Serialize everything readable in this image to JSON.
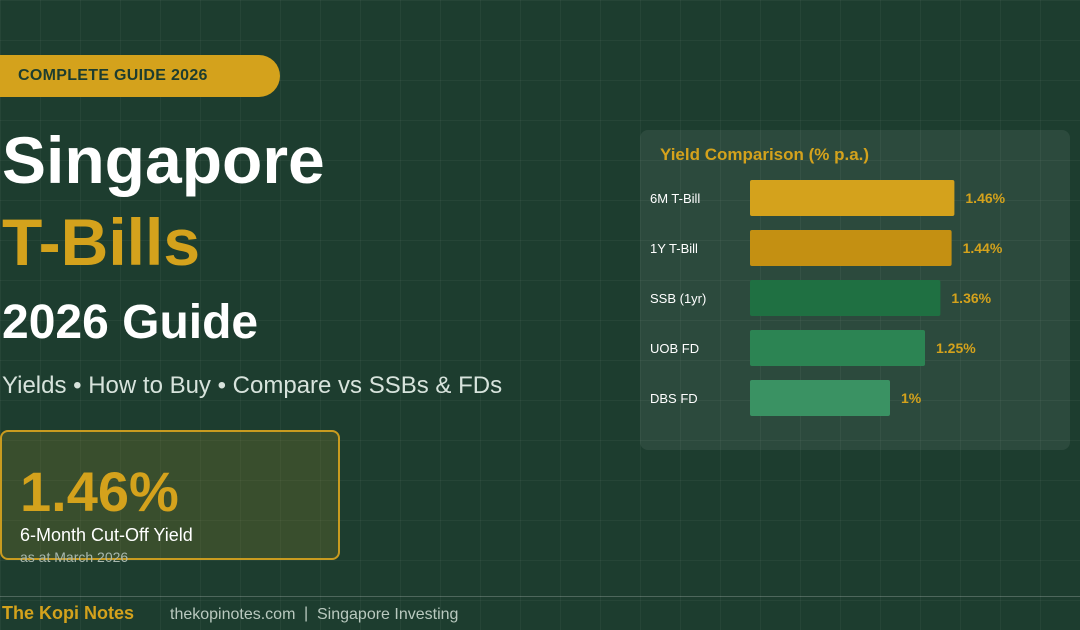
{
  "badge": {
    "label": "COMPLETE GUIDE 2026"
  },
  "headline": {
    "line1": "Singapore",
    "line2": "T-Bills",
    "line3": "2026 Guide",
    "subtitle": "Yields • How to Buy • Compare vs SSBs & FDs"
  },
  "stat": {
    "value": "1.46%",
    "label": "6-Month Cut-Off Yield",
    "date": "as at March 2026"
  },
  "footer": {
    "brand": "The Kopi Notes",
    "site": "thekopinotes.com",
    "separator": "|",
    "tagline": "Singapore Investing"
  },
  "colors": {
    "background": "#1d3d2f",
    "accent_gold": "#d4a21c",
    "green_dark": "#1f7042",
    "green_mid": "#2c8453",
    "green_light": "#3a9263"
  },
  "chart_data": {
    "type": "bar",
    "orientation": "horizontal",
    "title": "Yield Comparison (% p.a.)",
    "categories": [
      "6M T-Bill",
      "1Y T-Bill",
      "SSB (1yr)",
      "UOB FD",
      "DBS FD"
    ],
    "values": [
      1.46,
      1.44,
      1.36,
      1.25,
      1.0
    ],
    "value_labels": [
      "1.46%",
      "1.44%",
      "1.36%",
      "1.25%",
      "1%"
    ],
    "bar_colors": [
      "#d4a21c",
      "#c49012",
      "#1f7042",
      "#2c8453",
      "#3a9263"
    ],
    "label_color": "#d4a21c",
    "xlim": [
      0,
      2
    ],
    "grid": false,
    "legend": "none"
  }
}
